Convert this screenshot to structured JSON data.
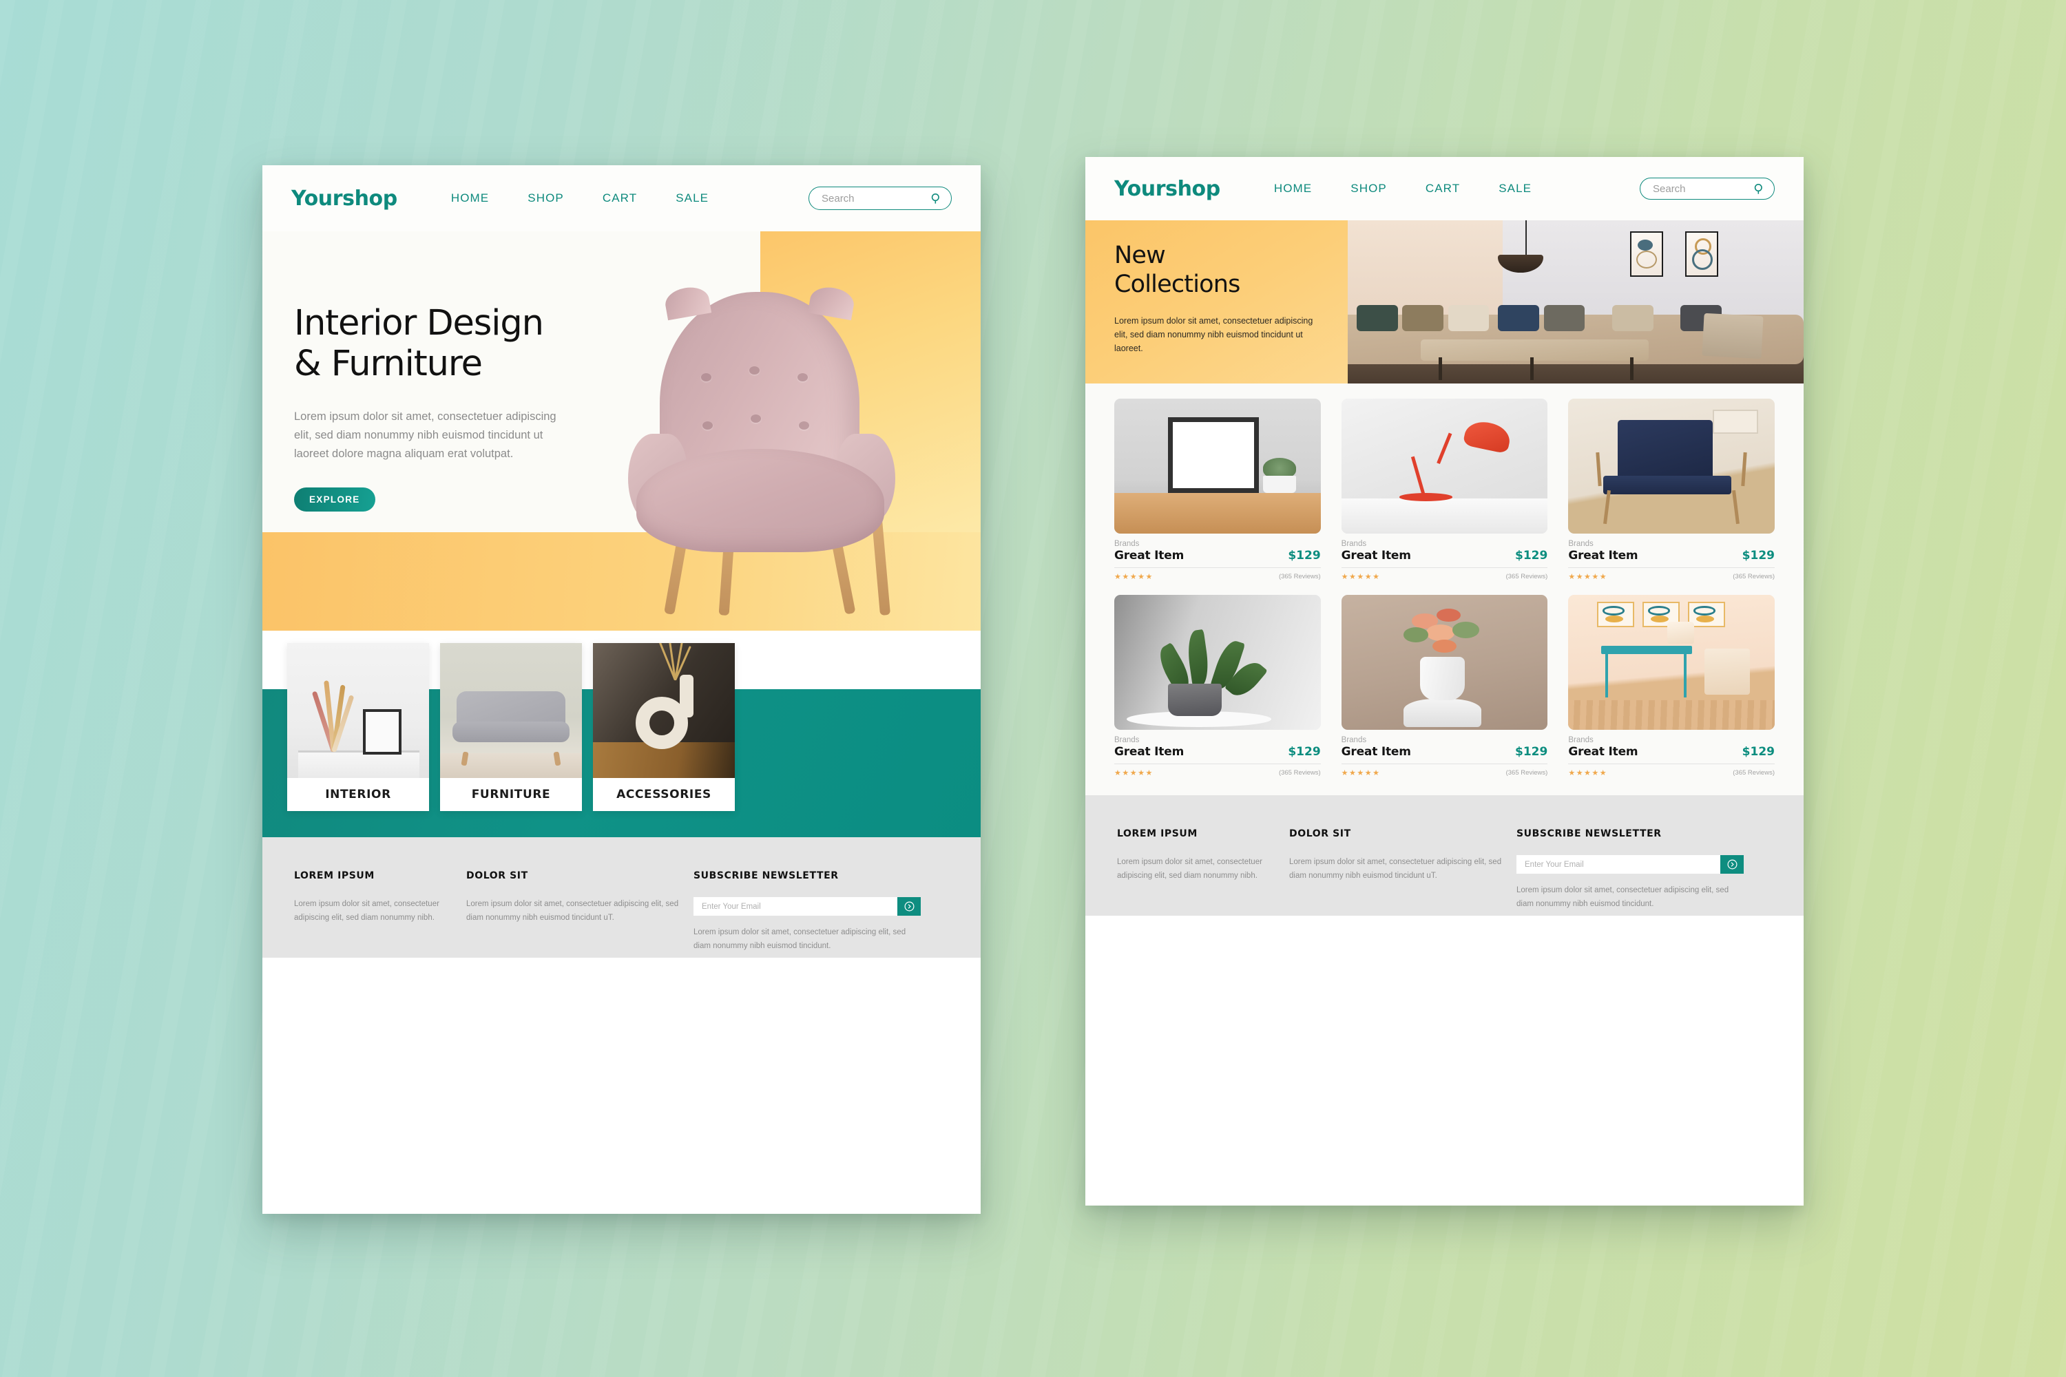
{
  "brand": {
    "logo": "Yourshop"
  },
  "nav": {
    "items": [
      "HOME",
      "SHOP",
      "CART",
      "SALE"
    ],
    "search_placeholder": "Search"
  },
  "left_page": {
    "hero": {
      "title_line1": "Interior Design",
      "title_line2": "& Furniture",
      "paragraph": "Lorem ipsum dolor sit amet, consectetuer adipiscing elit, sed diam nonummy nibh euismod tincidunt ut laoreet dolore magna aliquam erat volutpat.",
      "cta_label": "EXPLORE"
    },
    "categories": [
      {
        "label": "INTERIOR"
      },
      {
        "label": "FURNITURE"
      },
      {
        "label": "ACCESSORIES"
      }
    ]
  },
  "right_page": {
    "hero": {
      "title_line1": "New",
      "title_line2": "Collections",
      "paragraph": "Lorem ipsum dolor sit amet, consectetuer adipiscing elit, sed diam nonummy nibh euismod tincidunt ut laoreet."
    },
    "products": [
      {
        "brand": "Brands",
        "name": "Great Item",
        "price": "$129",
        "stars": "★★★★★",
        "reviews": "(365 Reviews)"
      },
      {
        "brand": "Brands",
        "name": "Great Item",
        "price": "$129",
        "stars": "★★★★★",
        "reviews": "(365 Reviews)"
      },
      {
        "brand": "Brands",
        "name": "Great Item",
        "price": "$129",
        "stars": "★★★★★",
        "reviews": "(365 Reviews)"
      },
      {
        "brand": "Brands",
        "name": "Great Item",
        "price": "$129",
        "stars": "★★★★★",
        "reviews": "(365 Reviews)"
      },
      {
        "brand": "Brands",
        "name": "Great Item",
        "price": "$129",
        "stars": "★★★★★",
        "reviews": "(365 Reviews)"
      },
      {
        "brand": "Brands",
        "name": "Great Item",
        "price": "$129",
        "stars": "★★★★★",
        "reviews": "(365 Reviews)"
      }
    ]
  },
  "footer": {
    "col1_title": "LOREM IPSUM",
    "col1_text": "Lorem ipsum dolor sit amet, consectetuer adipiscing elit, sed diam nonummy nibh.",
    "col2_title": "DOLOR SIT",
    "col2_text": "Lorem ipsum dolor sit amet, consectetuer adipiscing elit, sed diam nonummy nibh euismod tincidunt uT.",
    "col3_title": "SUBSCRIBE NEWSLETTER",
    "email_placeholder": "Enter Your Email",
    "col3_text": "Lorem ipsum dolor sit amet, consectetuer adipiscing elit, sed diam nonummy nibh euismod tincidunt."
  },
  "colors": {
    "teal": "#0e8a7d",
    "teal_dark": "#0b7a6e",
    "yellow": "#fbc568",
    "price": "#0c8d7f",
    "star": "#f0a84c",
    "footer_bg": "#e4e4e4"
  }
}
